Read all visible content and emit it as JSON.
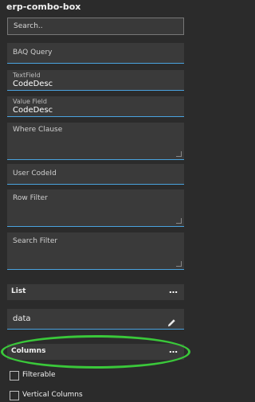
{
  "window": {
    "title": "erp-combo-box"
  },
  "search": {
    "placeholder": "Search.."
  },
  "fields": {
    "baq_query": {
      "label": "BAQ Query"
    },
    "text_field": {
      "label": "TextField",
      "value": "CodeDesc"
    },
    "value_field": {
      "label": "Value Field",
      "value": "CodeDesc"
    },
    "where_clause": {
      "label": "Where Clause"
    },
    "user_codeid": {
      "label": "User CodeId"
    },
    "row_filter": {
      "label": "Row Filter"
    },
    "search_filter": {
      "label": "Search Filter"
    }
  },
  "list_section": {
    "label": "List",
    "menu": "…"
  },
  "data_field": {
    "value": "data"
  },
  "columns_section": {
    "label": "Columns",
    "menu": "…"
  },
  "options": {
    "filterable": {
      "label": "Filterable"
    },
    "vertical_columns": {
      "label": "Vertical Columns"
    }
  },
  "colors": {
    "accent": "#4aa3df",
    "highlight": "#3ac83a",
    "background": "#2b2b2b"
  }
}
